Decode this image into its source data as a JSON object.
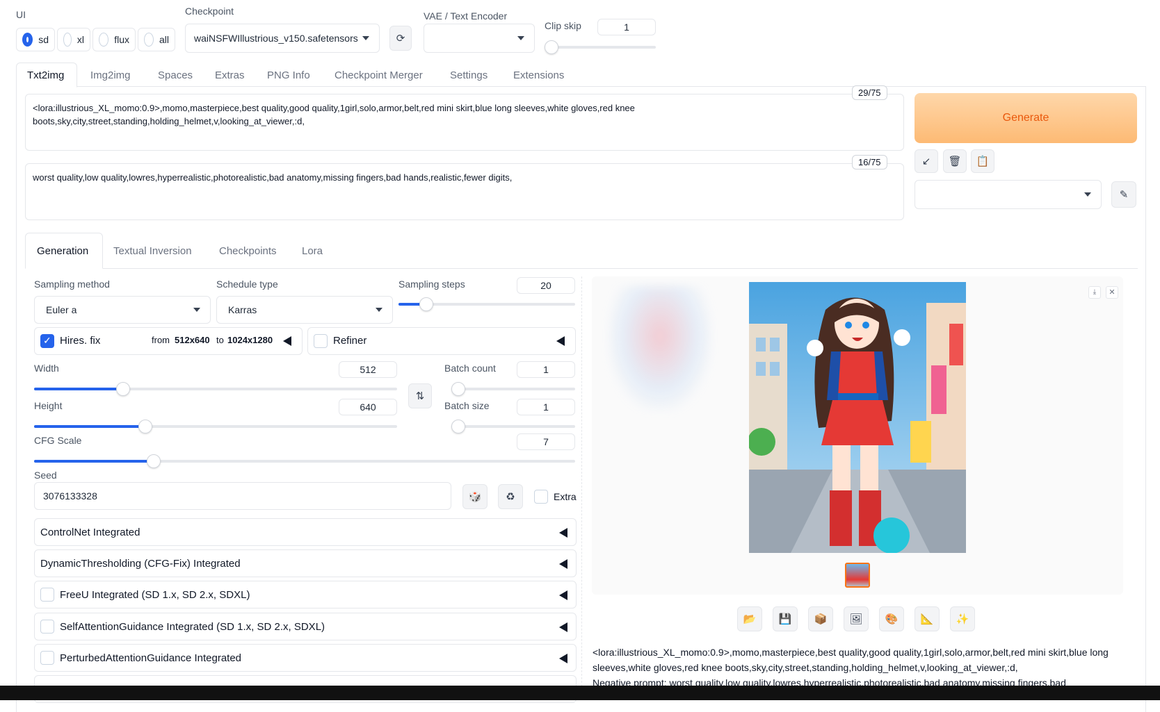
{
  "ui_mode": {
    "label": "UI",
    "options": [
      "sd",
      "xl",
      "flux",
      "all"
    ],
    "selected": "sd"
  },
  "checkpoint": {
    "label": "Checkpoint",
    "value": "waiNSFWIllustrious_v150.safetensors"
  },
  "vae": {
    "label": "VAE / Text Encoder",
    "value": ""
  },
  "clip_skip": {
    "label": "Clip skip",
    "value": "1"
  },
  "main_tabs": [
    "Txt2img",
    "Img2img",
    "Spaces",
    "Extras",
    "PNG Info",
    "Checkpoint Merger",
    "Settings",
    "Extensions"
  ],
  "prompt": {
    "text": "<lora:illustrious_XL_momo:0.9>,momo,masterpiece,best quality,good quality,1girl,solo,armor,belt,red mini skirt,blue long sleeves,white gloves,red knee boots,sky,city,street,standing,holding_helmet,v,looking_at_viewer,:d,",
    "counter": "29/75"
  },
  "negative_prompt": {
    "text": "worst quality,low quality,lowres,hyperrealistic,photorealistic,bad anatomy,missing fingers,bad hands,realistic,fewer digits,",
    "counter": "16/75"
  },
  "generate_label": "Generate",
  "sub_tabs": [
    "Generation",
    "Textual Inversion",
    "Checkpoints",
    "Lora"
  ],
  "sampling_method": {
    "label": "Sampling method",
    "value": "Euler a"
  },
  "schedule_type": {
    "label": "Schedule type",
    "value": "Karras"
  },
  "sampling_steps": {
    "label": "Sampling steps",
    "value": "20",
    "fraction": 0.13
  },
  "hires": {
    "label": "Hires. fix",
    "from_text": "from",
    "from_value": "512x640",
    "to_text": "to",
    "to_value": "1024x1280",
    "checked": true
  },
  "refiner": {
    "label": "Refiner",
    "checked": false
  },
  "width": {
    "label": "Width",
    "value": "512",
    "fraction": 0.235
  },
  "height": {
    "label": "Height",
    "value": "640",
    "fraction": 0.298
  },
  "batch_count": {
    "label": "Batch count",
    "value": "1",
    "fraction": 0.0
  },
  "batch_size": {
    "label": "Batch size",
    "value": "1",
    "fraction": 0.0
  },
  "cfg_scale": {
    "label": "CFG Scale",
    "value": "7",
    "fraction": 0.214
  },
  "seed": {
    "label": "Seed",
    "value": "3076133328",
    "extra_label": "Extra"
  },
  "accordions": [
    {
      "label": "ControlNet Integrated",
      "checkbox": false
    },
    {
      "label": "DynamicThresholding (CFG-Fix) Integrated",
      "checkbox": false
    },
    {
      "label": "FreeU Integrated (SD 1.x, SD 2.x, SDXL)",
      "checkbox": true
    },
    {
      "label": "SelfAttentionGuidance Integrated (SD 1.x, SD 2.x, SDXL)",
      "checkbox": true
    },
    {
      "label": "PerturbedAttentionGuidance Integrated",
      "checkbox": true
    }
  ],
  "output_info": {
    "line1": "<lora:illustrious_XL_momo:0.9>,momo,masterpiece,best quality,good quality,1girl,solo,armor,belt,red mini skirt,blue long",
    "line2": "sleeves,white gloves,red knee boots,sky,city,street,standing,holding_helmet,v,looking_at_viewer,:d,",
    "line3": "Negative prompt: worst quality,low quality,lowres,hyperrealistic,photorealistic,bad anatomy,missing fingers,bad"
  },
  "icons": [
    "refresh-icon",
    "arrow-icon",
    "trash-icon",
    "clipboard-icon",
    "pencil-icon",
    "swap-icon",
    "dice-icon",
    "recycle-icon",
    "folder-icon",
    "save-icon",
    "zip-icon",
    "image-icon",
    "palette-icon",
    "ruler-icon",
    "sparkle-icon",
    "download-icon",
    "close-icon"
  ],
  "colors": {
    "accent": "#2563eb",
    "generate_bg": "#fdba74",
    "generate_text": "#ea580c"
  }
}
